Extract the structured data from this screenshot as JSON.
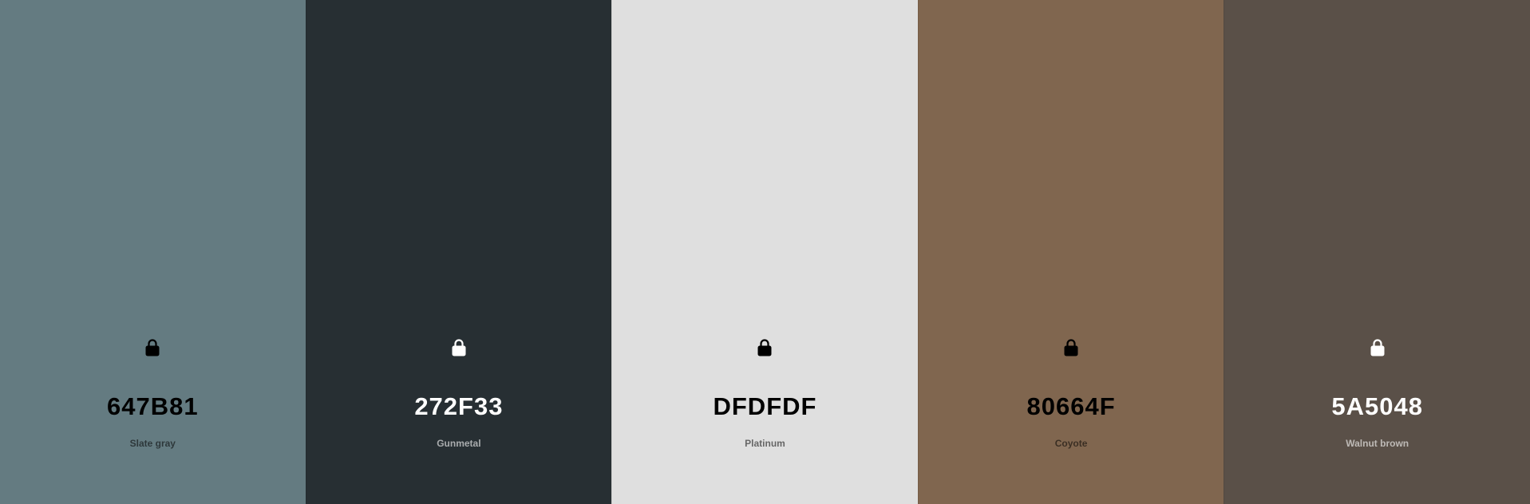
{
  "palette": {
    "colors": [
      {
        "hex": "647B81",
        "name": "Slate gray",
        "bg": "#647B81",
        "text_tone": "dark",
        "lock_icon": "lock-icon"
      },
      {
        "hex": "272F33",
        "name": "Gunmetal",
        "bg": "#272F33",
        "text_tone": "light",
        "lock_icon": "lock-icon"
      },
      {
        "hex": "DFDFDF",
        "name": "Platinum",
        "bg": "#DFDFDF",
        "text_tone": "dark",
        "lock_icon": "lock-icon"
      },
      {
        "hex": "80664F",
        "name": "Coyote",
        "bg": "#80664F",
        "text_tone": "dark",
        "lock_icon": "lock-icon"
      },
      {
        "hex": "5A5048",
        "name": "Walnut brown",
        "bg": "#5A5048",
        "text_tone": "light",
        "lock_icon": "lock-icon"
      }
    ]
  }
}
